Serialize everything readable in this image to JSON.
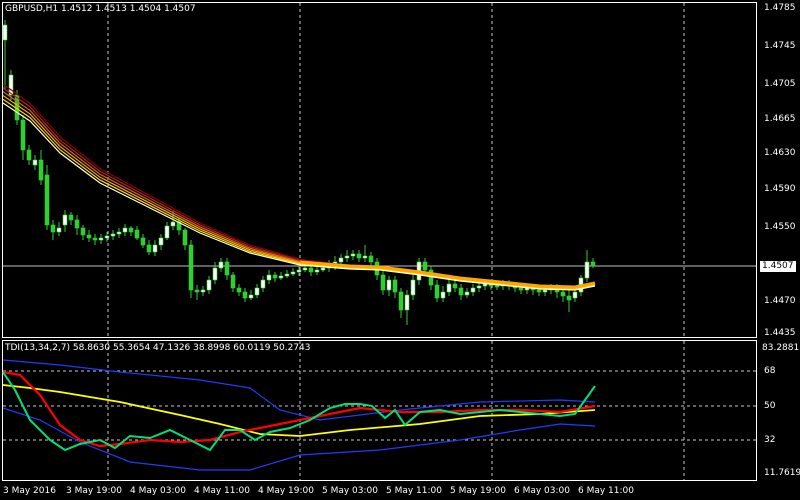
{
  "main_title": "GBPUSD,H1  1.4512 1.4513 1.4504 1.4507",
  "current_price": "1.4507",
  "price_ticks": [
    "1.4785",
    "1.4745",
    "1.4705",
    "1.4665",
    "1.4630",
    "1.4590",
    "1.4550",
    "1.4510",
    "1.4470",
    "1.4435"
  ],
  "ind_title": "TDI(13,34,2,7) 58.8630 55.3654 47.1326 38.8998 60.0119 50.2743",
  "ind_ticks": [
    "83.2881",
    "68",
    "50",
    "32",
    "11.7619"
  ],
  "time_ticks": [
    "3 May 2016",
    "3 May 19:00",
    "4 May 03:00",
    "4 May 11:00",
    "4 May 19:00",
    "5 May 03:00",
    "5 May 11:00",
    "5 May 19:00",
    "6 May 03:00",
    "6 May 11:00"
  ],
  "colors": {
    "bull": "#32cd32",
    "bear": "#ffffff",
    "grid": "#c8c8c8",
    "ema": [
      "#8b0000",
      "#b22222",
      "#d2691e",
      "#ffa500",
      "#ffd700",
      "#ffffe0"
    ],
    "tdi_green": "#00e07a",
    "tdi_red": "#ff0000",
    "tdi_yellow": "#ffff00",
    "tdi_blue": "#1e3cff"
  }
}
